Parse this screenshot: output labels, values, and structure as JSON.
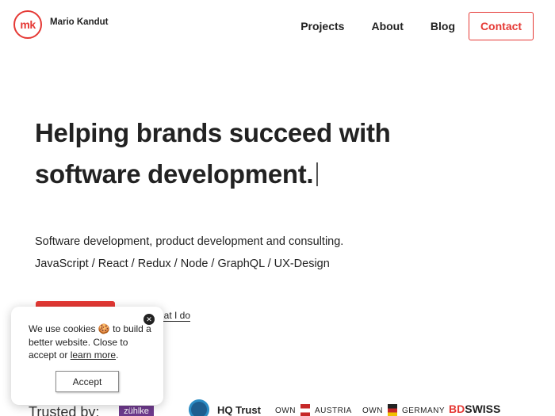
{
  "header": {
    "logo_initials": "mk",
    "logo_name": "Mario Kandut",
    "nav": [
      {
        "label": "Projects"
      },
      {
        "label": "About"
      },
      {
        "label": "Blog"
      }
    ],
    "contact_label": "Contact"
  },
  "hero": {
    "title": "Helping brands succeed with software development.",
    "subtitle_line1": "Software development, product development and consulting.",
    "subtitle_line2": "JavaScript / React / Redux / Node / GraphQL / UX-Design",
    "secondary_link": "hat I do"
  },
  "trusted": {
    "label": "Trusted by:",
    "clients": {
      "zuhlke": "zühlke",
      "hq": "HQ Trust",
      "own_austria_prefix": "OWN",
      "own_austria_suffix": "AUSTRIA",
      "own_germany_prefix": "OWN",
      "own_germany_suffix": "GERMANY",
      "bds_red": "BD",
      "bds_dark": "SWISS"
    }
  },
  "cookie": {
    "text_before": "We use cookies 🍪 to build a better website. Close to accept or ",
    "link": "learn more",
    "text_after": ".",
    "close_symbol": "✕",
    "accept_label": "Accept"
  },
  "colors": {
    "accent": "#e53935"
  }
}
